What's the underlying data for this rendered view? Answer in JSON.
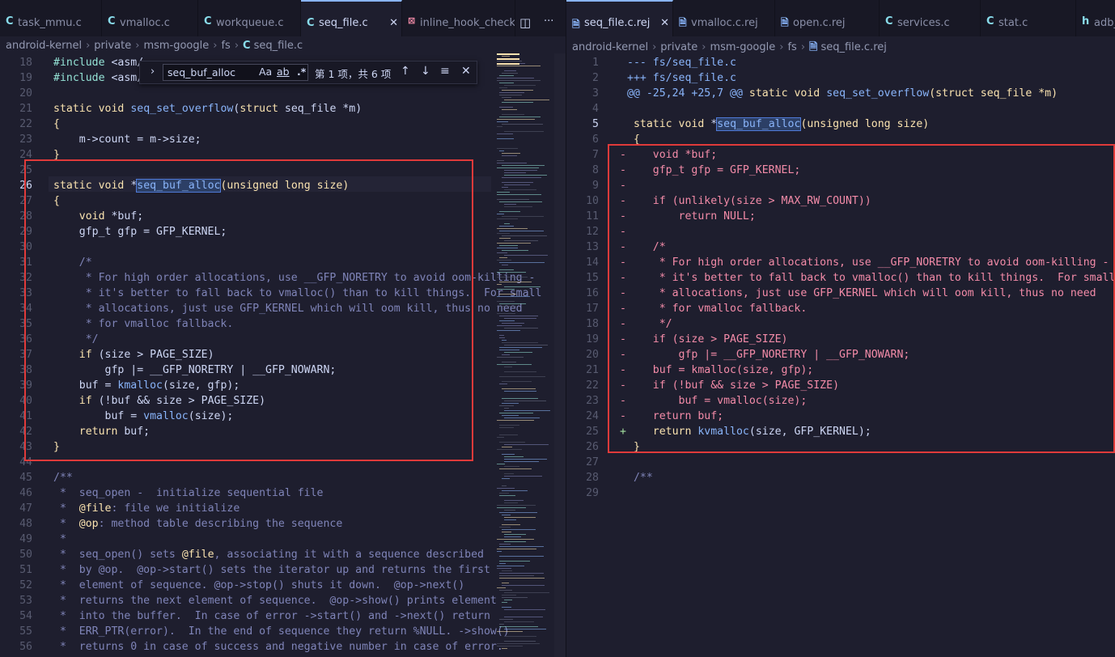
{
  "left_tabs": [
    {
      "label": "task_mmu.c",
      "icon": "c"
    },
    {
      "label": "vmalloc.c",
      "icon": "c"
    },
    {
      "label": "workqueue.c",
      "icon": "c"
    },
    {
      "label": "seq_file.c",
      "icon": "c",
      "active": true
    },
    {
      "label": "inline_hook_check.r",
      "icon": "r"
    }
  ],
  "right_tabs": [
    {
      "label": "seq_file.c.rej",
      "icon": "rej",
      "active": true
    },
    {
      "label": "vmalloc.c.rej",
      "icon": "rej"
    },
    {
      "label": "open.c.rej",
      "icon": "rej"
    },
    {
      "label": "services.c",
      "icon": "c"
    },
    {
      "label": "stat.c",
      "icon": "c"
    },
    {
      "label": "adb_",
      "icon": "h"
    }
  ],
  "icons": {
    "c": "C",
    "rej": "🗎",
    "h": "h",
    "r": "⊠",
    "close": "✕",
    "split": "◫",
    "more": "···"
  },
  "left_breadcrumb": [
    "android-kernel",
    "private",
    "msm-google",
    "fs",
    "seq_file.c"
  ],
  "right_breadcrumb": [
    "android-kernel",
    "private",
    "msm-google",
    "fs",
    "seq_file.c.rej"
  ],
  "find_widget": {
    "toggle": "›",
    "query": "seq_buf_alloc",
    "match_case": "Aa",
    "whole_word": "ab",
    "regex": ".*",
    "result": "第 1 项，共 6 项",
    "prev": "↑",
    "next": "↓",
    "in_selection": "≡",
    "close": "✕"
  },
  "left_lines": [
    {
      "n": "18",
      "h": "<span class=\"op\">#include</span> <span class=\"pl\">&lt;asm/</span>"
    },
    {
      "n": "19",
      "h": "<span class=\"op\">#include</span> <span class=\"pl\">&lt;asm/</span>"
    },
    {
      "n": "20",
      "h": ""
    },
    {
      "n": "21",
      "h": "<span class=\"kw\">static</span> <span class=\"kw\">void</span> <span class=\"fn\">seq_set_overflow</span><span class=\"pl\">(</span><span class=\"kw\">struct</span> <span class=\"pl\">seq_file *m)</span>"
    },
    {
      "n": "22",
      "h": "<span class=\"kw\">{</span>"
    },
    {
      "n": "23",
      "h": "    <span class=\"pl\">m-&gt;count = m-&gt;size;</span>"
    },
    {
      "n": "24",
      "h": "<span class=\"kw\">}</span>"
    },
    {
      "n": "25",
      "h": ""
    },
    {
      "n": "26",
      "cur": true,
      "h": "<span class=\"kw\">static</span> <span class=\"kw\">void</span> <span class=\"pl\">*</span><span class=\"fn hlw\">seq_buf_alloc</span><span class=\"kw\">(unsigned long size)</span>"
    },
    {
      "n": "27",
      "h": "<span class=\"kw\">{</span>"
    },
    {
      "n": "28",
      "h": "    <span class=\"kw\">void</span> <span class=\"pl\">*buf;</span>"
    },
    {
      "n": "29",
      "h": "    <span class=\"pl\">gfp_t gfp = GFP_KERNEL;</span>"
    },
    {
      "n": "30",
      "h": ""
    },
    {
      "n": "31",
      "h": "    <span class=\"cm\">/*</span>"
    },
    {
      "n": "32",
      "h": "     <span class=\"cm\">* For high order allocations, use __GFP_NORETRY to avoid oom-killing -</span>"
    },
    {
      "n": "33",
      "h": "     <span class=\"cm\">* it's better to fall back to vmalloc() than to kill things.  For small</span>"
    },
    {
      "n": "34",
      "h": "     <span class=\"cm\">* allocations, just use GFP_KERNEL which will oom kill, thus no need</span>"
    },
    {
      "n": "35",
      "h": "     <span class=\"cm\">* for vmalloc fallback.</span>"
    },
    {
      "n": "36",
      "h": "     <span class=\"cm\">*/</span>"
    },
    {
      "n": "37",
      "h": "    <span class=\"kw\">if</span> <span class=\"pl\">(size &gt; PAGE_SIZE)</span>"
    },
    {
      "n": "38",
      "h": "        <span class=\"pl\">gfp |= __GFP_NORETRY | __GFP_NOWARN;</span>"
    },
    {
      "n": "39",
      "h": "    <span class=\"pl\">buf = </span><span class=\"fn\">kmalloc</span><span class=\"pl\">(size, gfp);</span>"
    },
    {
      "n": "40",
      "h": "    <span class=\"kw\">if</span> <span class=\"pl\">(!buf &amp;&amp; size &gt; PAGE_SIZE)</span>"
    },
    {
      "n": "41",
      "h": "        <span class=\"pl\">buf = </span><span class=\"fn\">vmalloc</span><span class=\"pl\">(size);</span>"
    },
    {
      "n": "42",
      "h": "    <span class=\"kw\">return</span> <span class=\"pl\">buf;</span>"
    },
    {
      "n": "43",
      "h": "<span class=\"kw\">}</span>"
    },
    {
      "n": "44",
      "h": ""
    },
    {
      "n": "45",
      "h": "<span class=\"cm2\">/**</span>"
    },
    {
      "n": "46",
      "h": " <span class=\"cm2\">*  seq_open -  initialize sequential file</span>"
    },
    {
      "n": "47",
      "h": " <span class=\"cm2\">*  </span><span class=\"kw\">@file</span><span class=\"cm2\">: file we initialize</span>"
    },
    {
      "n": "48",
      "h": " <span class=\"cm2\">*  </span><span class=\"kw\">@op</span><span class=\"cm2\">: method table describing the sequence</span>"
    },
    {
      "n": "49",
      "h": " <span class=\"cm2\">*</span>"
    },
    {
      "n": "50",
      "h": " <span class=\"cm2\">*  seq_open() sets </span><span class=\"kw\">@file</span><span class=\"cm2\">, associating it with a sequence described</span>"
    },
    {
      "n": "51",
      "h": " <span class=\"cm2\">*  by @op.  @op-&gt;start() sets the iterator up and returns the first</span>"
    },
    {
      "n": "52",
      "h": " <span class=\"cm2\">*  element of sequence. @op-&gt;stop() shuts it down.  @op-&gt;next()</span>"
    },
    {
      "n": "53",
      "h": " <span class=\"cm2\">*  returns the next element of sequence.  @op-&gt;show() prints element</span>"
    },
    {
      "n": "54",
      "h": " <span class=\"cm2\">*  into the buffer.  In case of error -&gt;start() and -&gt;next() return</span>"
    },
    {
      "n": "55",
      "h": " <span class=\"cm2\">*  ERR_PTR(error).  In the end of sequence they return %NULL. -&gt;show()</span>"
    },
    {
      "n": "56",
      "h": " <span class=\"cm2\">*  returns 0 in case of success and negative number in case of error.</span>"
    }
  ],
  "right_lines": [
    {
      "n": "1",
      "m": "",
      "h": "<span class=\"meta\">--- fs/seq_file.c</span>"
    },
    {
      "n": "2",
      "m": "",
      "h": "<span class=\"meta\">+++ fs/seq_file.c</span>"
    },
    {
      "n": "3",
      "m": "",
      "h": "<span class=\"meta\">@@ -25,24 +25,7 @@</span> <span class=\"kw\">static</span> <span class=\"kw\">void</span> <span class=\"fn\">seq_set_overflow</span><span class=\"kw\">(struct seq_file *m)</span>"
    },
    {
      "n": "4",
      "m": "",
      "h": ""
    },
    {
      "n": "5",
      "m": "",
      "cur": true,
      "h": " <span class=\"kw\">static</span> <span class=\"kw\">void</span> <span class=\"pl\">*</span><span class=\"fn hlw\">seq_buf_alloc</span><span class=\"kw\">(unsigned long size)</span>"
    },
    {
      "n": "6",
      "m": "",
      "h": " <span class=\"kw\">{</span>"
    },
    {
      "n": "7",
      "m": "-",
      "h": "<span class=\"del\">    void *buf;</span>"
    },
    {
      "n": "8",
      "m": "-",
      "h": "<span class=\"del\">    gfp_t gfp = GFP_KERNEL;</span>"
    },
    {
      "n": "9",
      "m": "-",
      "h": ""
    },
    {
      "n": "10",
      "m": "-",
      "h": "<span class=\"del\">    if (unlikely(size &gt; MAX_RW_COUNT))</span>"
    },
    {
      "n": "11",
      "m": "-",
      "h": "<span class=\"del\">        return NULL;</span>"
    },
    {
      "n": "12",
      "m": "-",
      "h": ""
    },
    {
      "n": "13",
      "m": "-",
      "h": "<span class=\"del\">    /*</span>"
    },
    {
      "n": "14",
      "m": "-",
      "h": "<span class=\"del\">     * For high order allocations, use __GFP_NORETRY to avoid oom-killing -</span>"
    },
    {
      "n": "15",
      "m": "-",
      "h": "<span class=\"del\">     * it's better to fall back to vmalloc() than to kill things.  For small</span>"
    },
    {
      "n": "16",
      "m": "-",
      "h": "<span class=\"del\">     * allocations, just use GFP_KERNEL which will oom kill, thus no need</span>"
    },
    {
      "n": "17",
      "m": "-",
      "h": "<span class=\"del\">     * for vmalloc fallback.</span>"
    },
    {
      "n": "18",
      "m": "-",
      "h": "<span class=\"del\">     */</span>"
    },
    {
      "n": "19",
      "m": "-",
      "h": "<span class=\"del\">    if (size &gt; PAGE_SIZE)</span>"
    },
    {
      "n": "20",
      "m": "-",
      "h": "<span class=\"del\">        gfp |= __GFP_NORETRY | __GFP_NOWARN;</span>"
    },
    {
      "n": "21",
      "m": "-",
      "h": "<span class=\"del\">    buf = kmalloc(size, gfp);</span>"
    },
    {
      "n": "22",
      "m": "-",
      "h": "<span class=\"del\">    if (!buf &amp;&amp; size &gt; PAGE_SIZE)</span>"
    },
    {
      "n": "23",
      "m": "-",
      "h": "<span class=\"del\">        buf = vmalloc(size);</span>"
    },
    {
      "n": "24",
      "m": "-",
      "h": "<span class=\"del\">    return buf;</span>"
    },
    {
      "n": "25",
      "m": "+",
      "h": "    <span class=\"kw\">return</span> <span class=\"fn\">kvmalloc</span><span class=\"pl\">(size, GFP_KERNEL);</span>"
    },
    {
      "n": "26",
      "m": "",
      "h": " <span class=\"kw\">}</span>"
    },
    {
      "n": "27",
      "m": "",
      "h": ""
    },
    {
      "n": "28",
      "m": "",
      "h": " <span class=\"cm2\">/**</span>"
    },
    {
      "n": "29",
      "m": "",
      "h": ""
    }
  ]
}
